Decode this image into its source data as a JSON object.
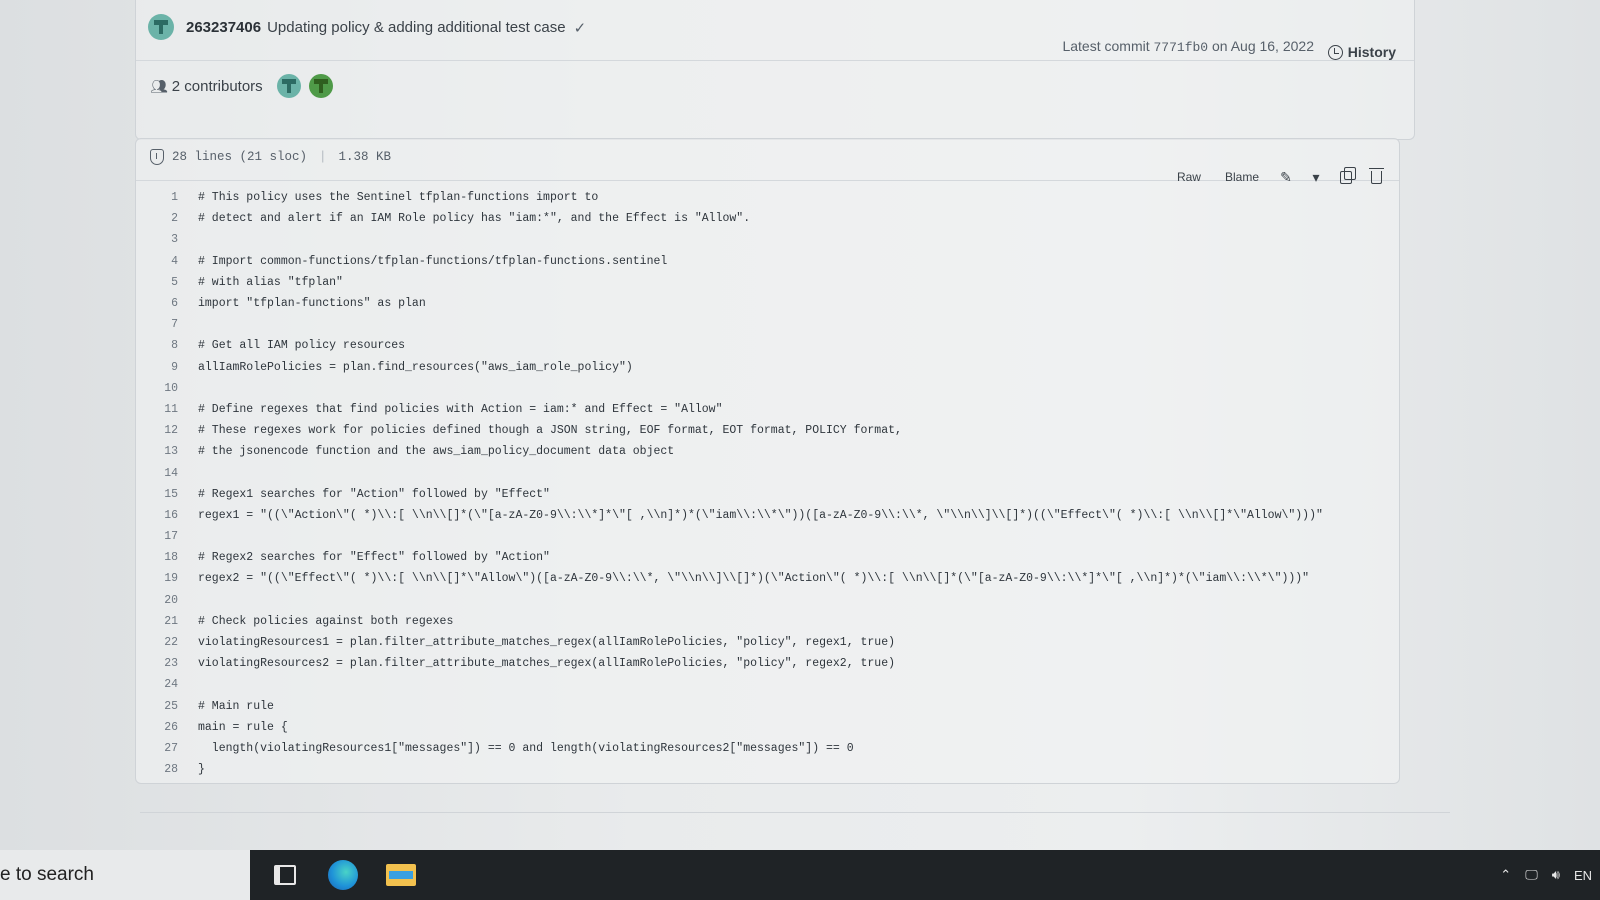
{
  "commit": {
    "id": "263237406",
    "message": "Updating policy & adding additional test case",
    "latest_prefix": "Latest commit",
    "latest_sha": "7771fb0",
    "latest_date": "on Aug 16, 2022",
    "history_label": "History"
  },
  "contributors": {
    "label": "2 contributors"
  },
  "file": {
    "lines_info": "28 lines (21 sloc)",
    "size": "1.38 KB",
    "raw_label": "Raw",
    "blame_label": "Blame"
  },
  "code_lines": [
    {
      "n": "1",
      "text": "# This policy uses the Sentinel tfplan-functions import to"
    },
    {
      "n": "2",
      "text": "# detect and alert if an IAM Role policy has \"iam:*\", and the Effect is \"Allow\"."
    },
    {
      "n": "3",
      "text": ""
    },
    {
      "n": "4",
      "text": "# Import common-functions/tfplan-functions/tfplan-functions.sentinel"
    },
    {
      "n": "5",
      "text": "# with alias \"tfplan\""
    },
    {
      "n": "6",
      "text": "import \"tfplan-functions\" as plan"
    },
    {
      "n": "7",
      "text": ""
    },
    {
      "n": "8",
      "text": "# Get all IAM policy resources"
    },
    {
      "n": "9",
      "text": "allIamRolePolicies = plan.find_resources(\"aws_iam_role_policy\")"
    },
    {
      "n": "10",
      "text": ""
    },
    {
      "n": "11",
      "text": "# Define regexes that find policies with Action = iam:* and Effect = \"Allow\""
    },
    {
      "n": "12",
      "text": "# These regexes work for policies defined though a JSON string, EOF format, EOT format, POLICY format,"
    },
    {
      "n": "13",
      "text": "# the jsonencode function and the aws_iam_policy_document data object"
    },
    {
      "n": "14",
      "text": ""
    },
    {
      "n": "15",
      "text": "# Regex1 searches for \"Action\" followed by \"Effect\""
    },
    {
      "n": "16",
      "text": "regex1 = \"((\\\"Action\\\"( *)\\\\:[ \\\\n\\\\[]*(\\\"[a-zA-Z0-9\\\\:\\\\*]*\\\"[ ,\\\\n]*)*(\\\"iam\\\\:\\\\*\\\"))([a-zA-Z0-9\\\\:\\\\*, \\\"\\\\n\\\\]\\\\[]*)((\\\"Effect\\\"( *)\\\\:[ \\\\n\\\\[]*\\\"Allow\\\")))\""
    },
    {
      "n": "17",
      "text": ""
    },
    {
      "n": "18",
      "text": "# Regex2 searches for \"Effect\" followed by \"Action\""
    },
    {
      "n": "19",
      "text": "regex2 = \"((\\\"Effect\\\"( *)\\\\:[ \\\\n\\\\[]*\\\"Allow\\\")([a-zA-Z0-9\\\\:\\\\*, \\\"\\\\n\\\\]\\\\[]*)(\\\"Action\\\"( *)\\\\:[ \\\\n\\\\[]*(\\\"[a-zA-Z0-9\\\\:\\\\*]*\\\"[ ,\\\\n]*)*(\\\"iam\\\\:\\\\*\\\")))\""
    },
    {
      "n": "20",
      "text": ""
    },
    {
      "n": "21",
      "text": "# Check policies against both regexes"
    },
    {
      "n": "22",
      "text": "violatingResources1 = plan.filter_attribute_matches_regex(allIamRolePolicies, \"policy\", regex1, true)"
    },
    {
      "n": "23",
      "text": "violatingResources2 = plan.filter_attribute_matches_regex(allIamRolePolicies, \"policy\", regex2, true)"
    },
    {
      "n": "24",
      "text": ""
    },
    {
      "n": "25",
      "text": "# Main rule"
    },
    {
      "n": "26",
      "text": "main = rule {"
    },
    {
      "n": "27",
      "text": "  length(violatingResources1[\"messages\"]) == 0 and length(violatingResources2[\"messages\"]) == 0"
    },
    {
      "n": "28",
      "text": "}"
    }
  ],
  "taskbar": {
    "search_text": "e to search",
    "language": "EN"
  }
}
